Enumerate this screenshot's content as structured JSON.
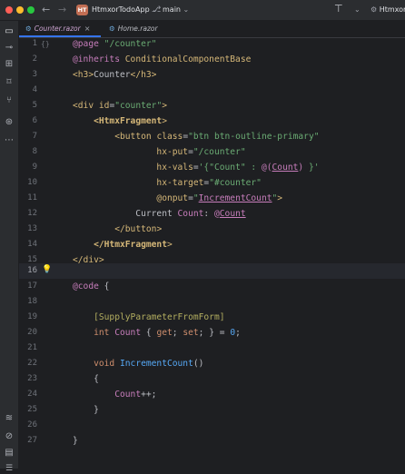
{
  "titlebar": {
    "back_icon": "←",
    "forward_icon": "→",
    "project_badge": "HT",
    "project_name": "HtmxorTodoApp",
    "branch_icon": "⎇",
    "branch_name": "main",
    "right_icon": "⊤",
    "right_chevron": "⌄",
    "right_name": "Htmxor"
  },
  "sidebar": {
    "icons": [
      "folder-icon",
      "commit-icon",
      "structure-icon",
      "bookmark-icon",
      "pull-request-icon",
      "plugins-icon",
      "more-icon",
      "database-icon",
      "run-icon",
      "terminal-icon",
      "problems-icon"
    ]
  },
  "tabs": [
    {
      "label": "Counter.razor",
      "close": "×",
      "icon": "⚙"
    },
    {
      "label": "Home.razor",
      "icon": "⚙"
    }
  ],
  "editor": {
    "line_numbers": [
      "1",
      "2",
      "3",
      "4",
      "5",
      "6",
      "7",
      "8",
      "9",
      "10",
      "11",
      "12",
      "13",
      "14",
      "15",
      "16",
      "17",
      "18",
      "19",
      "20",
      "21",
      "22",
      "23",
      "24",
      "25",
      "26",
      "27"
    ],
    "lines": [
      "@page \"/counter\"",
      "@inherits ConditionalComponentBase",
      "<h3>Counter</h3>",
      "",
      "<div id=\"counter\">",
      "    <HtmxFragment>",
      "        <button class=\"btn btn-outline-primary\"",
      "                hx-put=\"/counter\"",
      "                hx-vals='{\"Count\" : @(Count) }'",
      "                hx-target=\"#counter\"",
      "                @onput=\"IncrementCount\">",
      "            Current Count: @Count",
      "        </button>",
      "    </HtmxFragment>",
      "</div>",
      "",
      "@code {",
      "",
      "    [SupplyParameterFromForm]",
      "    int Count { get; set; } = 0;",
      "",
      "    void IncrementCount()",
      "    {",
      "        Count++;",
      "    }",
      "",
      "}"
    ]
  }
}
